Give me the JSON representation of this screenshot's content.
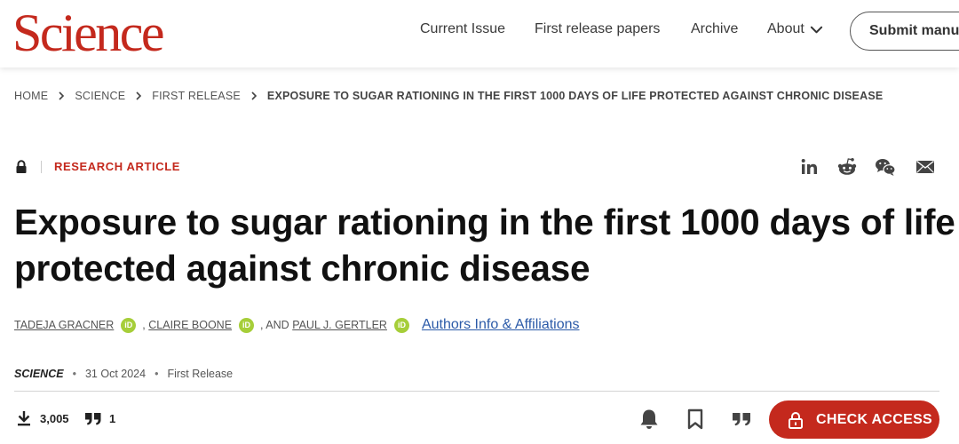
{
  "header": {
    "logo": "Science",
    "nav": {
      "current_issue": "Current Issue",
      "first_release": "First release papers",
      "archive": "Archive",
      "about": "About"
    },
    "submit_label": "Submit manus"
  },
  "breadcrumb": {
    "home": "HOME",
    "science": "SCIENCE",
    "first_release": "FIRST RELEASE",
    "current": "EXPOSURE TO SUGAR RATIONING IN THE FIRST 1000 DAYS OF LIFE PROTECTED AGAINST CHRONIC DISEASE"
  },
  "article": {
    "type": "RESEARCH ARTICLE",
    "title": "Exposure to sugar rationing in the first 1000 days of life protected against chronic disease",
    "authors": {
      "a1": "TADEJA GRACNER",
      "sep1": ",",
      "a2": "CLAIRE BOONE",
      "sep2": ", AND",
      "a3": "PAUL J. GERTLER",
      "affiliations_link": "Authors Info & Affiliations",
      "orcid_label": "iD"
    },
    "meta": {
      "journal": "SCIENCE",
      "bullet": "•",
      "date": "31 Oct 2024",
      "status": "First Release"
    }
  },
  "metrics": {
    "downloads": "3,005",
    "citations": "1"
  },
  "share_icons": [
    "linkedin-icon",
    "reddit-icon",
    "wechat-icon",
    "email-icon"
  ],
  "tools": [
    "alert-bell-icon",
    "bookmark-icon",
    "cite-icon"
  ],
  "access_button": "CHECK ACCESS",
  "colors": {
    "brand_red": "#c4291d",
    "orcid_green": "#a6ce39",
    "link_blue": "#2b5aa8"
  }
}
